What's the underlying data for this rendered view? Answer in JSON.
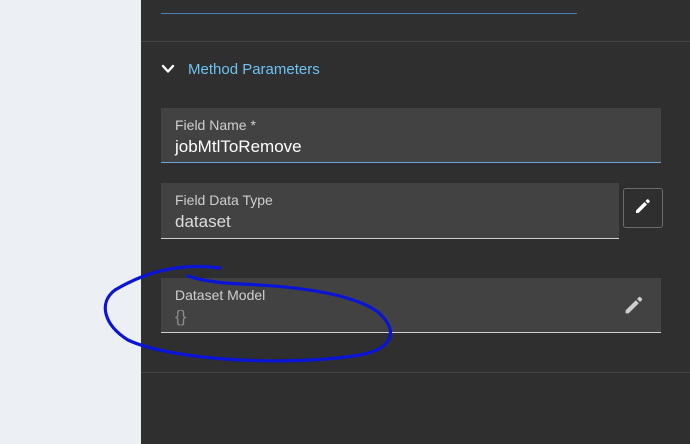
{
  "section": {
    "title": "Method Parameters",
    "expanded": true
  },
  "fields": {
    "field_name": {
      "label": "Field Name *",
      "value": "jobMtlToRemove"
    },
    "field_data_type": {
      "label": "Field Data Type",
      "value": "dataset"
    },
    "dataset_model": {
      "label": "Dataset Model",
      "value": "{}"
    }
  },
  "icons": {
    "section_toggle": "chevron-down-icon",
    "edit_data_type": "pencil-icon",
    "edit_dataset_model": "pencil-icon"
  },
  "colors": {
    "panel_background": "#2f2f2f",
    "field_background": "#424242",
    "accent": "#6ec3f2",
    "annotation_ink": "#0a14d6"
  }
}
